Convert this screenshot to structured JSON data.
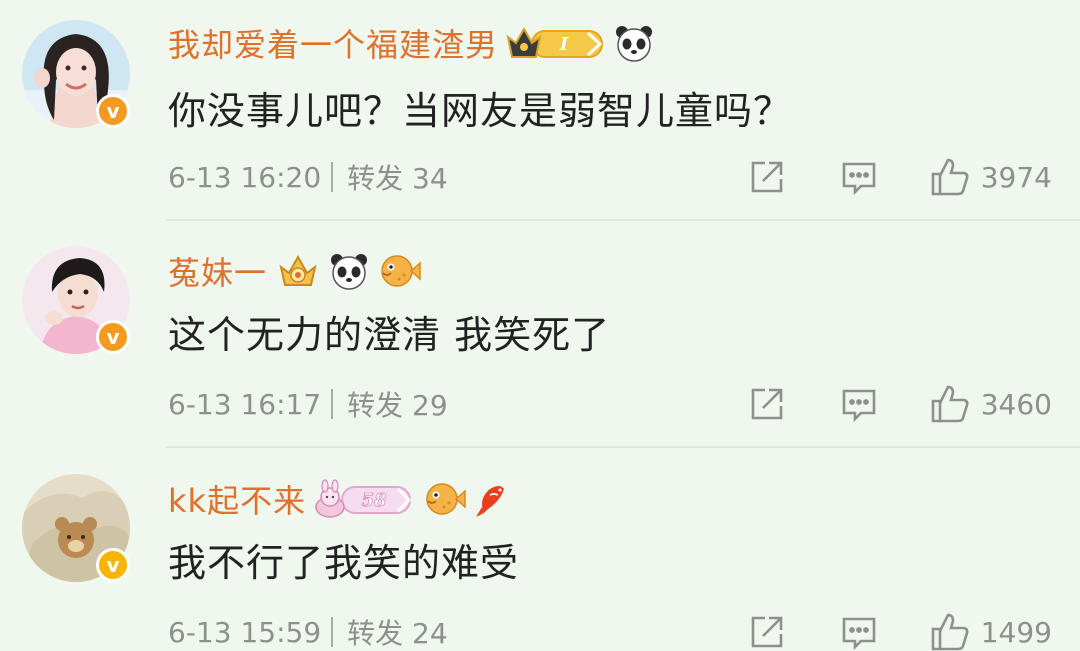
{
  "comments": [
    {
      "username": "我却爱着一个福建渣男",
      "medals": [
        "crown-level-medal",
        "panda-icon"
      ],
      "medal_text": "I",
      "content": "你没事儿吧？当网友是弱智儿童吗？",
      "time": "6-13 16:20",
      "repost": "转发 34",
      "likes": "3974",
      "badge": "v"
    },
    {
      "username": "菟妹一",
      "medals": [
        "golden-crown-medal",
        "panda-icon",
        "pufferfish-icon"
      ],
      "content": "这个无力的澄清 我笑死了",
      "time": "6-13 16:17",
      "repost": "转发 29",
      "likes": "3460",
      "badge": "v"
    },
    {
      "username": "kk起不来",
      "medals": [
        "bunny-level-medal",
        "pufferfish-icon",
        "koi-fish-icon"
      ],
      "medal_text": "58",
      "content": "我不行了我笑的难受",
      "time": "6-13 15:59",
      "repost": "转发 24",
      "likes": "1499",
      "badge": "v"
    }
  ],
  "colors": {
    "background": "#eff7ee",
    "username": "#e0712b",
    "content": "#222222",
    "meta": "#8c928b",
    "verified_orange": "#f39a1f",
    "verified_yellow": "#f7b500"
  }
}
